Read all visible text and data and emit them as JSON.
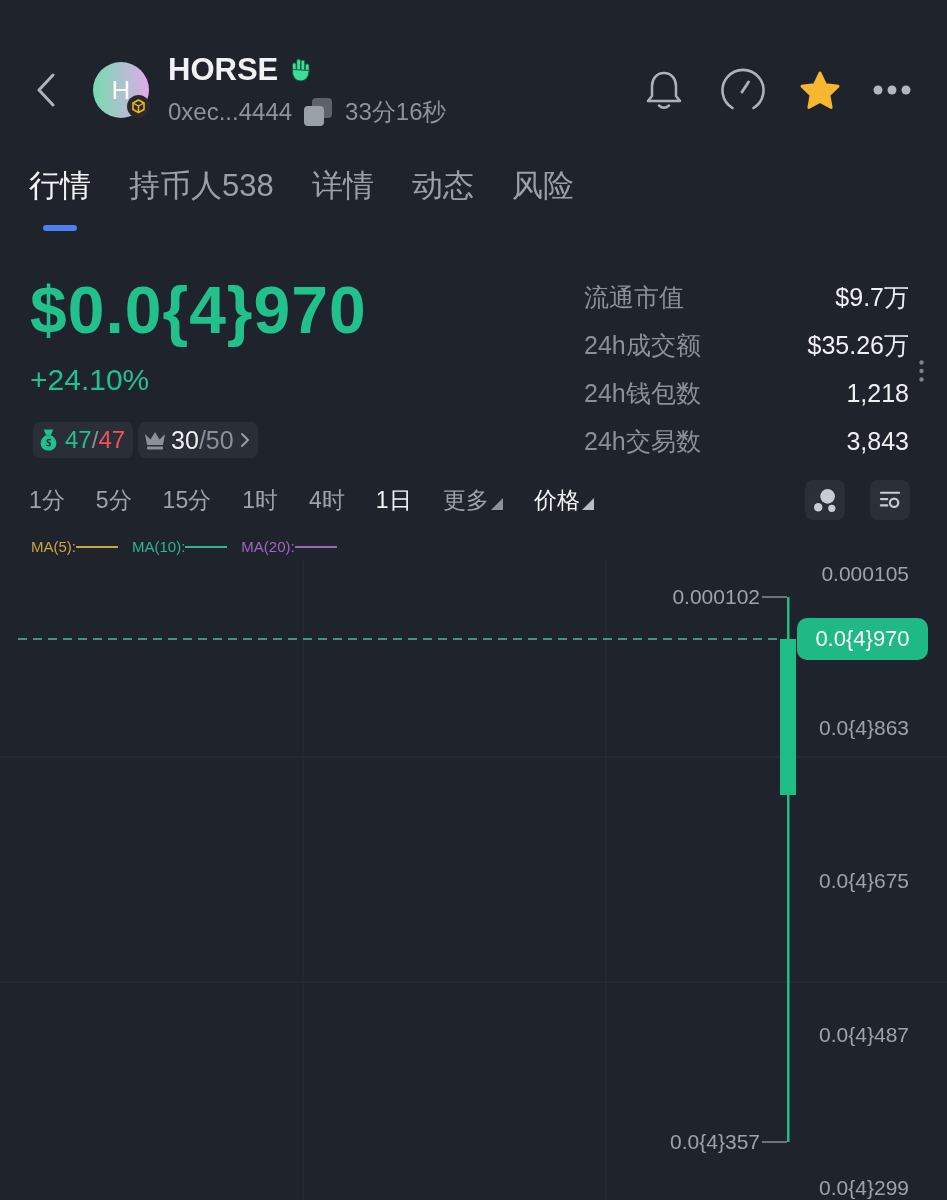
{
  "token": {
    "avatar_letter": "H",
    "name": "HORSE",
    "address": "0xec...4444",
    "age": "33分16秒",
    "favorited": true
  },
  "tabs": [
    {
      "label": "行情",
      "selected": true
    },
    {
      "label": "持币人538",
      "selected": false
    },
    {
      "label": "详情",
      "selected": false
    },
    {
      "label": "动态",
      "selected": false
    },
    {
      "label": "风险",
      "selected": false
    }
  ],
  "price": {
    "value": "$0.0{4}970",
    "change": "+24.10%"
  },
  "badges": [
    {
      "kind": "money",
      "parts": [
        "47",
        "/",
        "47"
      ]
    },
    {
      "kind": "top",
      "parts": [
        "30",
        "/50"
      ]
    }
  ],
  "stats": [
    {
      "label": "流通市值",
      "value": "$9.7万"
    },
    {
      "label": "24h成交额",
      "value": "$35.26万"
    },
    {
      "label": "24h钱包数",
      "value": "1,218"
    },
    {
      "label": "24h交易数",
      "value": "3,843"
    }
  ],
  "intervals": [
    {
      "label": "1分",
      "kind": "interval",
      "selected": false
    },
    {
      "label": "5分",
      "kind": "interval",
      "selected": false
    },
    {
      "label": "15分",
      "kind": "interval",
      "selected": false
    },
    {
      "label": "1时",
      "kind": "interval",
      "selected": false
    },
    {
      "label": "4时",
      "kind": "interval",
      "selected": false
    },
    {
      "label": "1日",
      "kind": "interval",
      "selected": true
    },
    {
      "label": "更多",
      "kind": "dropdown",
      "selected": false
    },
    {
      "label": "价格",
      "kind": "dropdown",
      "selected": true
    }
  ],
  "ma_legend": [
    {
      "label": "MA(5):",
      "color": "#c8a63c"
    },
    {
      "label": "MA(10):",
      "color": "#2db597"
    },
    {
      "label": "MA(20):",
      "color": "#a265c0"
    }
  ],
  "chart": {
    "y_axis": [
      "0.000105",
      "0.0{4}863",
      "0.0{4}675",
      "0.0{4}487",
      "0.0{4}299"
    ],
    "high_label": "0.000102",
    "low_label": "0.0{4}357",
    "current_price": "0.0{4}970"
  }
}
